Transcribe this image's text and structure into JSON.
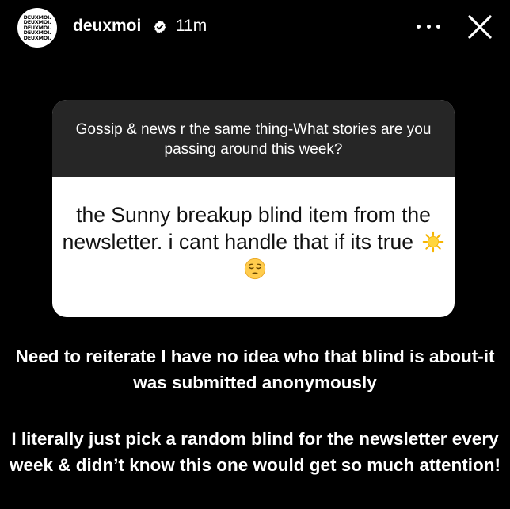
{
  "story": {
    "account": {
      "username": "deuxmoi",
      "time_ago": "11m",
      "avatar_text": [
        "DEUXMOI.",
        "DEUXMOI.",
        "DEUXMOI.",
        "DEUXMOI.",
        "DEUXMOI."
      ],
      "verified": true
    },
    "question_box": {
      "prompt": "Gossip & news r the same thing-What stories are you passing around this week?",
      "answer": "the Sunny breakup blind item from the newsletter. i cant handle that if its true",
      "answer_emojis": [
        "sun-emoji",
        "pensive-face-emoji"
      ]
    },
    "caption": {
      "paragraph_1": "Need to reiterate I have no idea who that blind is  about-it was submitted anonymously",
      "paragraph_2": "I literally just pick a random blind for the newsletter every week & didn’t know this one would get so much attention!"
    },
    "icons": {
      "more": "more-options-icon",
      "close": "close-icon",
      "verified": "verified-badge-icon"
    },
    "colors": {
      "background": "#000000",
      "question_header": "#262626",
      "answer_background": "#ffffff",
      "verified_badge": "#ffffff"
    }
  }
}
